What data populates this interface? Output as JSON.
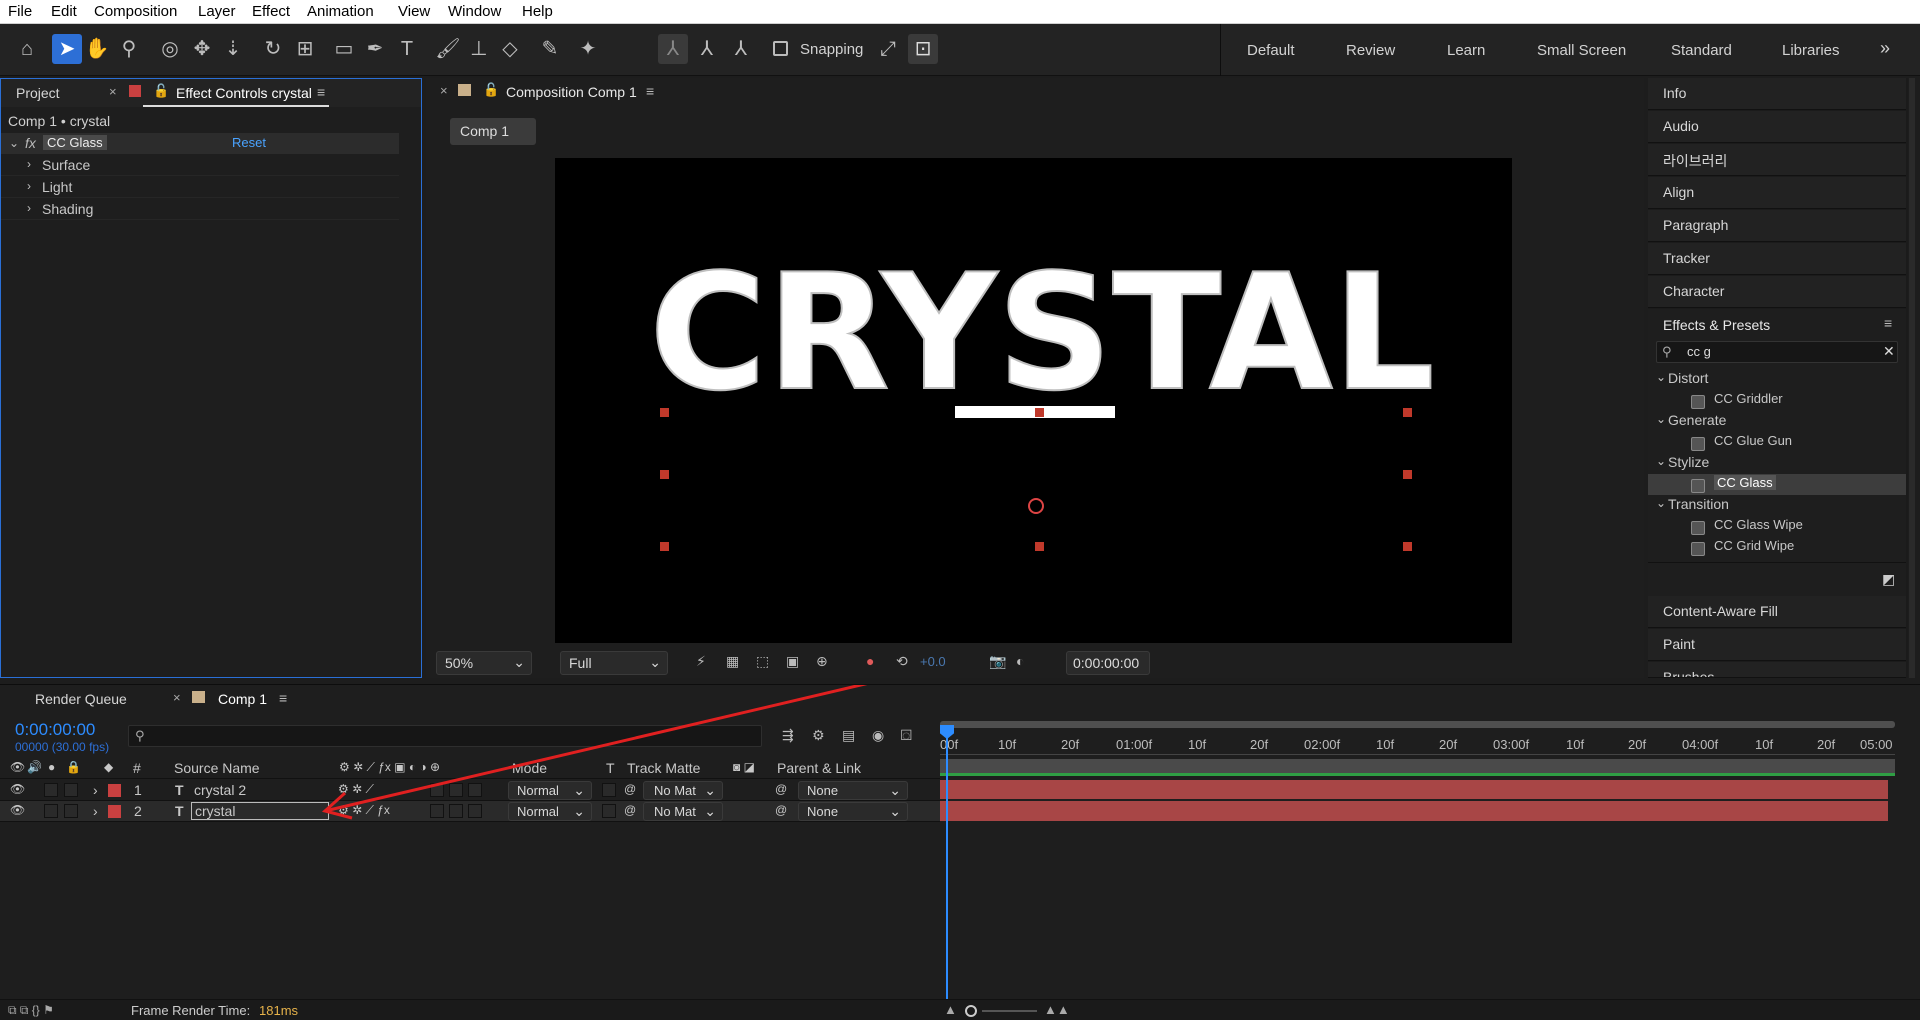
{
  "menu": [
    "File",
    "Edit",
    "Composition",
    "Layer",
    "Effect",
    "Animation",
    "View",
    "Window",
    "Help"
  ],
  "toolbar": {
    "snapping_label": "Snapping",
    "workspaces": [
      "Default",
      "Review",
      "Learn",
      "Small Screen",
      "Standard",
      "Libraries"
    ],
    "more": "»"
  },
  "left_panel": {
    "tabs": {
      "project": "Project",
      "effect_controls": "Effect Controls crystal"
    },
    "breadcrumb": "Comp 1 • crystal",
    "effect": {
      "fx": "fx",
      "name": "CC Glass",
      "reset": "Reset"
    },
    "groups": [
      "Surface",
      "Light",
      "Shading"
    ]
  },
  "comp_panel": {
    "tab": "Composition Comp 1",
    "comp_button": "Comp 1",
    "canvas_text": "CRYSTAL",
    "zoom": "50%",
    "resolution": "Full",
    "exposure": "+0.0",
    "timecode": "0:00:00:00",
    "colors": {
      "canvas": "#000000",
      "text": "#ffffff",
      "handle": "#c0392b"
    }
  },
  "right_panel": {
    "items_top": [
      "Info",
      "Audio",
      "라이브러리",
      "Align",
      "Paragraph",
      "Tracker",
      "Character"
    ],
    "effects_presets": {
      "title": "Effects & Presets",
      "search": "cc g",
      "tree": [
        {
          "category": "Distort",
          "items": [
            "CC Griddler"
          ]
        },
        {
          "category": "Generate",
          "items": [
            "CC Glue Gun"
          ]
        },
        {
          "category": "Stylize",
          "items": [
            "CC Glass"
          ]
        },
        {
          "category": "Transition",
          "items": [
            "CC Glass Wipe",
            "CC Grid Wipe"
          ]
        }
      ],
      "selected": "CC Glass"
    },
    "items_bottom": [
      "Content-Aware Fill",
      "Paint",
      "Brushes"
    ]
  },
  "timeline": {
    "tabs": {
      "render_queue": "Render Queue",
      "comp": "Comp 1"
    },
    "timecode": "0:00:00:00",
    "fps": "00000 (30.00 fps)",
    "columns": {
      "num": "#",
      "source": "Source Name",
      "mode": "Mode",
      "t": "T",
      "matte": "Track Matte",
      "parent": "Parent & Link"
    },
    "layers": [
      {
        "num": "1",
        "name": "crystal 2",
        "mode": "Normal",
        "matte": "No Mat",
        "parent": "None"
      },
      {
        "num": "2",
        "name": "crystal",
        "mode": "Normal",
        "matte": "No Mat",
        "parent": "None"
      }
    ],
    "ruler": [
      "00f",
      "10f",
      "20f",
      "01:00f",
      "10f",
      "20f",
      "02:00f",
      "10f",
      "20f",
      "03:00f",
      "10f",
      "20f",
      "04:00f",
      "10f",
      "20f",
      "05:00"
    ],
    "status_label": "Frame Render Time:",
    "status_value": "181ms",
    "colors": {
      "accent": "#2d8cff",
      "layer_bar": "#a84646",
      "status_value": "#e6b24a"
    }
  }
}
